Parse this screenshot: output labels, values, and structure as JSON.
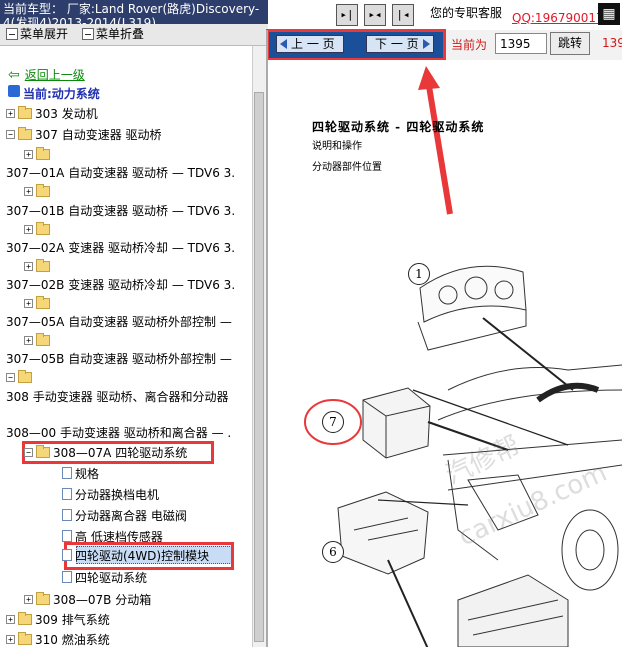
{
  "header": {
    "vehicle_label": "当前车型：  厂家:Land Rover(路虎)Discovery-4(发现4)2013-2014(L319)",
    "expand_label": "菜单展开",
    "collapse_label": "菜单折叠",
    "support_label": "您的专职客服",
    "qq_label": "QQ:196790017"
  },
  "pagenav": {
    "prev_label": "上 一 页",
    "next_label": "下 一 页",
    "current_label": "当前为",
    "current_value": "1395",
    "jump_label": "跳转",
    "total_label": "139"
  },
  "tree": {
    "back_label": "返回上一级",
    "current_label": "当前:动力系统",
    "nodes": [
      {
        "label": "303 发动机"
      },
      {
        "label": "307 自动变速器 驱动桥"
      },
      {
        "label": ""
      },
      {
        "label": "307—01A 自动变速器 驱动桥 — TDV6 3."
      },
      {
        "label": ""
      },
      {
        "label": "307—01B 自动变速器 驱动桥 — TDV6 3."
      },
      {
        "label": ""
      },
      {
        "label": "307—02A 变速器 驱动桥冷却 — TDV6 3."
      },
      {
        "label": ""
      },
      {
        "label": "307—02B 变速器 驱动桥冷却 — TDV6 3."
      },
      {
        "label": ""
      },
      {
        "label": "307—05A 自动变速器 驱动桥外部控制 —"
      },
      {
        "label": ""
      },
      {
        "label": "307—05B 自动变速器 驱动桥外部控制 —"
      },
      {
        "label": ""
      },
      {
        "label": "308 手动变速器 驱动桥、离合器和分动器"
      },
      {
        "label": "308—00 手动变速器 驱动桥和离合器 — ."
      },
      {
        "label": "308—07A 四轮驱动系统"
      },
      {
        "label": "规格"
      },
      {
        "label": "分动器换档电机"
      },
      {
        "label": "分动器离合器 电磁阀"
      },
      {
        "label": "高 低速档传感器"
      },
      {
        "label": "四轮驱动(4WD)控制模块"
      },
      {
        "label": "四轮驱动系统"
      },
      {
        "label": "308—07B 分动箱"
      },
      {
        "label": "309 排气系统"
      },
      {
        "label": "310 燃油系统"
      }
    ]
  },
  "document": {
    "title": "四轮驱动系统 - 四轮驱动系统",
    "subtitle": "说明和操作",
    "section": "分动器部件位置",
    "callouts": [
      "1",
      "7",
      "6"
    ]
  },
  "colors": {
    "highlight_red": "#e8383a",
    "header_navy": "#2e3e6c",
    "nav_blue": "#1a5099"
  }
}
